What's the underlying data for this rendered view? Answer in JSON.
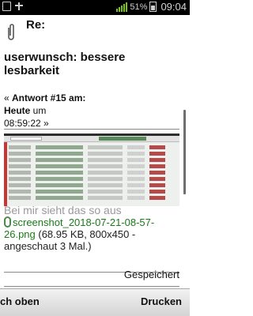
{
  "status_bar": {
    "battery": "51%",
    "time": "09:04"
  },
  "post": {
    "re_label": "Re:",
    "subject": "userwunsch: bessere lesbarkeit",
    "meta_prefix": "« ",
    "meta_answer": "Antwort #15 am:",
    "meta_day": "Heute",
    "meta_um": " um",
    "meta_time": "08:59:22 »",
    "caption_ghost": "Bei mir sieht das so aus",
    "attachment_name": "screenshot_2018-07-21-08-57-26.png",
    "attachment_info": " (68.95 KB, 800x450 - angeschaut 3 Mal.)",
    "saved_label": "Gespeichert"
  },
  "bottom_bar": {
    "up_label": "ch oben",
    "print_label": "Drucken"
  },
  "colors": {
    "link": "#1a7a1a",
    "signal": "#7cc21d"
  },
  "icons": [
    "notification-icon",
    "usb-icon",
    "paperclip-icon",
    "wifi-signal-icon",
    "battery-icon"
  ]
}
